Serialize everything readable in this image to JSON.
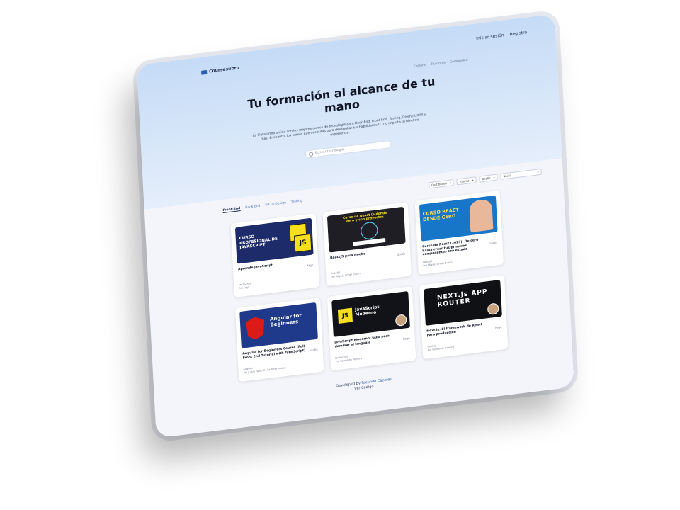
{
  "brand": {
    "name": "Coursesubro"
  },
  "topnav": [
    "Iniciar sesión",
    "Registro"
  ],
  "breadcrumbs": [
    "Explorar",
    "Favoritos",
    "Comunidad"
  ],
  "hero": {
    "title": "Tu formación al alcance de tu mano",
    "subtitle": "La Plataforma online con los mejores cursos de tecnología para Back-End, Front-End, Testing, Diseño UX/UI y más. Encuentra los cursos que necesitas para desarrollar tus habilidades IT, no importa tu nivel de experiencia."
  },
  "search": {
    "placeholder": "Buscar tecnología"
  },
  "tabs": [
    "Front-End",
    "Back-End",
    "UX UI Design",
    "Testing"
  ],
  "filters": [
    {
      "label": "Certificado"
    },
    {
      "label": "Idioma"
    },
    {
      "label": "Gratis"
    },
    {
      "label": "Nivel"
    }
  ],
  "courses": [
    {
      "thumb_text": "CURSO PROFESIONAL DE JAVASCRIPT",
      "title": "Aprende JavaScript",
      "price": "Pago",
      "meta_1": "JavaScript",
      "meta_2": "Por Digi"
    },
    {
      "thumb_text": "Curso de React (a donde cero y con proyectos",
      "title": "ReactJS para Noobs",
      "price": "Gratis",
      "meta_1": "ReactJS",
      "meta_2": "Por Miguel Ángel Durán"
    },
    {
      "thumb_text": "CURSO REACT DESDE CERO",
      "title": "Curso de React (2023): De cero hasta crear tus primeros componentes con estado",
      "price": "Gratis",
      "meta_1": "ReactJS",
      "meta_2": "Por Miguel Ángel Durán"
    },
    {
      "thumb_text": "Angular for Beginners",
      "title": "Angular for Beginners Course (Full Front End Tutorial with TypeScript)",
      "price": "Gratis",
      "meta_1": "Angular",
      "meta_2": "Por Justin Fabio De La Torre Araujo"
    },
    {
      "thumb_text": "JavaScript Moderno",
      "title": "JavaScript Moderno: Guía para dominar el lenguaje",
      "price": "Pago",
      "meta_1": "JavaScript",
      "meta_2": "Por Fernando Herrera"
    },
    {
      "thumb_text": "NEXT.js APP ROUTER",
      "title": "Next.js: El framework de React para producción",
      "price": "Pago",
      "meta_1": "Next.js",
      "meta_2": "Por Fernando Herrera"
    }
  ],
  "footer": {
    "prefix": "Developed by",
    "author": "Facundo Cáceres",
    "source": "Ver Código"
  },
  "colors": {
    "accent": "#2b5fb7",
    "hero_top": "#c5dbf6",
    "page_bg": "#f3f5fa"
  }
}
